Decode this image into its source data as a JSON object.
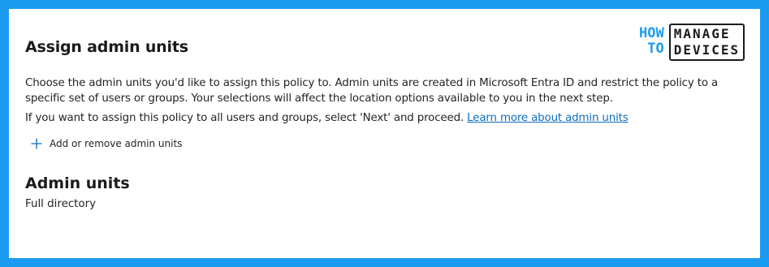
{
  "header": {
    "title": "Assign admin units"
  },
  "description": {
    "line1": "Choose the admin units you'd like to assign this policy to. Admin units are created in Microsoft Entra ID and restrict the policy to a specific set of users or groups. Your selections will affect the location options available to you in the next step.",
    "line2": "If you want to assign this policy to all users and groups, select 'Next' and proceed.",
    "learn_more_link": "Learn more about admin units"
  },
  "actions": {
    "add_remove_label": "Add or remove admin units",
    "icon": "plus-icon"
  },
  "admin_units": {
    "heading": "Admin units",
    "value": "Full directory"
  },
  "watermark": {
    "how": "HOW",
    "to": "TO",
    "manage": "MANAGE",
    "devices": "DEVICES"
  },
  "colors": {
    "border": "#1a9bf0",
    "link": "#0f6cbd",
    "accent_icon": "#0f6cbd"
  }
}
